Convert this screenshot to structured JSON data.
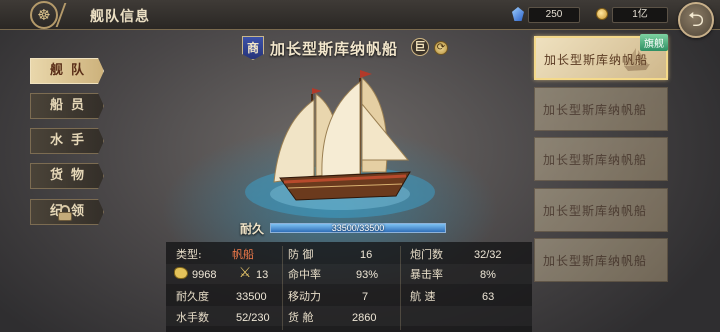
{
  "header": {
    "title": "舰队信息",
    "gems": "250",
    "coins": "1亿"
  },
  "nav": {
    "tabs": [
      {
        "label": "舰队",
        "active": true
      },
      {
        "label": "船员",
        "active": false
      },
      {
        "label": "水手",
        "active": false
      },
      {
        "label": "货物",
        "active": false
      },
      {
        "label": "纪领",
        "active": false,
        "locked": true
      }
    ]
  },
  "ship": {
    "class_badge": "商",
    "name": "加长型斯库纳帆船",
    "size_badge": "巨",
    "durability_label": "耐久",
    "durability_text": "33500/33500",
    "durability_fraction": 1.0
  },
  "stats": {
    "type_label": "类型:",
    "type_value": "帆船",
    "food_value": "9968",
    "crew_icon_value": "13",
    "endurance_label": "耐久度",
    "endurance_value": "33500",
    "sailors_label": "水手数",
    "sailors_value": "52/230",
    "defense_label": "防 御",
    "defense_value": "16",
    "accuracy_label": "命中率",
    "accuracy_value": "93%",
    "mobility_label": "移动力",
    "mobility_value": "7",
    "cargo_label": "货 舱",
    "cargo_value": "2860",
    "cannons_label": "炮门数",
    "cannons_value": "32/32",
    "crit_label": "暴击率",
    "crit_value": "8%",
    "speed_label": "航 速",
    "speed_value": "63"
  },
  "fleet": {
    "flag_tag": "旗舰",
    "cards": [
      {
        "name": "加长型斯库纳帆船",
        "selected": true
      },
      {
        "name": "加长型斯库纳帆船",
        "selected": false
      },
      {
        "name": "加长型斯库纳帆船",
        "selected": false
      },
      {
        "name": "加长型斯库纳帆船",
        "selected": false
      },
      {
        "name": "加长型斯库纳帆船",
        "selected": false
      }
    ]
  },
  "colors": {
    "accent_gold": "#cdb583",
    "type_value_red": "#f07a4a",
    "durability_blue": "#2f6fb8"
  }
}
